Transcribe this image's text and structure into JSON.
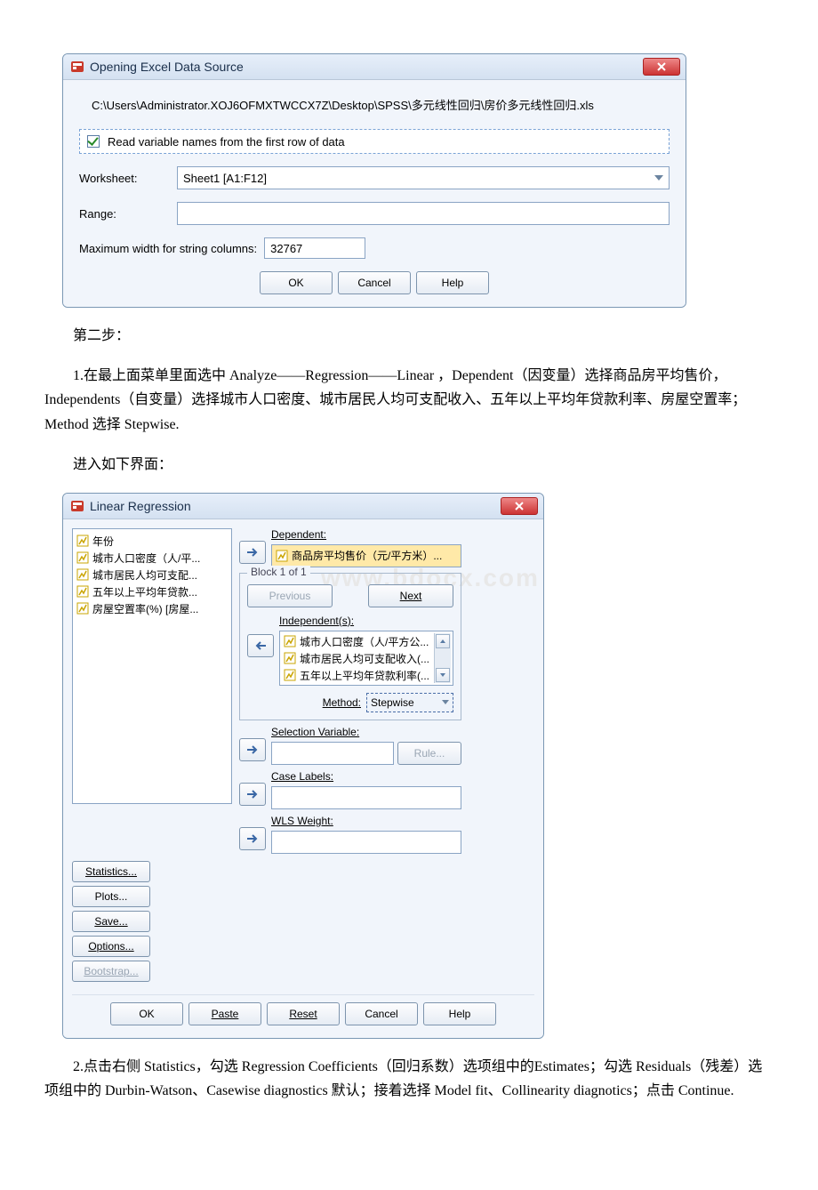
{
  "excel_dialog": {
    "title": "Opening Excel Data Source",
    "filepath": "C:\\Users\\Administrator.XOJ6OFMXTWCCX7Z\\Desktop\\SPSS\\多元线性回归\\房价多元线性回归.xls",
    "checkbox_label": "Read variable names from the first row of data",
    "worksheet_label": "Worksheet:",
    "worksheet_value": "Sheet1 [A1:F12]",
    "range_label": "Range:",
    "range_value": "",
    "maxwidth_label": "Maximum width for string columns:",
    "maxwidth_value": "32767",
    "buttons": {
      "ok": "OK",
      "cancel": "Cancel",
      "help": "Help"
    }
  },
  "doc": {
    "step2": "第二步：",
    "para1": "1.在最上面菜单里面选中 Analyze——Regression——Linear ，Dependent（因变量）选择商品房平均售价，Independents（自变量）选择城市人口密度、城市居民人均可支配收入、五年以上平均年贷款利率、房屋空置率；Method 选择 Stepwise.",
    "para_enter": "进入如下界面：",
    "para2": "2.点击右侧 Statistics，勾选 Regression Coefficients（回归系数）选项组中的Estimates；勾选 Residuals（残差）选项组中的 Durbin-Watson、Casewise diagnostics 默认；接着选择 Model fit、Collinearity diagnotics；点击 Continue."
  },
  "lr_dialog": {
    "title": "Linear Regression",
    "vars": [
      "年份",
      "城市人口密度（人/平...",
      "城市居民人均可支配...",
      "五年以上平均年贷款...",
      "房屋空置率(%) [房屋..."
    ],
    "dependent_label": "Dependent:",
    "dependent_value": "商品房平均售价（元/平方米）...",
    "block_legend": "Block 1 of 1",
    "prev": "Previous",
    "next": "Next",
    "independents_label": "Independent(s):",
    "independents": [
      "城市人口密度（人/平方公...",
      "城市居民人均可支配收入(...",
      "五年以上平均年贷款利率(..."
    ],
    "method_label": "Method:",
    "method_value": "Stepwise",
    "selvar_label": "Selection Variable:",
    "rule_btn": "Rule...",
    "caselabels_label": "Case Labels:",
    "wls_label": "WLS Weight:",
    "side_buttons": {
      "statistics": "Statistics...",
      "plots": "Plots...",
      "save": "Save...",
      "options": "Options...",
      "bootstrap": "Bootstrap..."
    },
    "bottom": {
      "ok": "OK",
      "paste": "Paste",
      "reset": "Reset",
      "cancel": "Cancel",
      "help": "Help"
    },
    "watermark": "www.bdocx.com"
  }
}
